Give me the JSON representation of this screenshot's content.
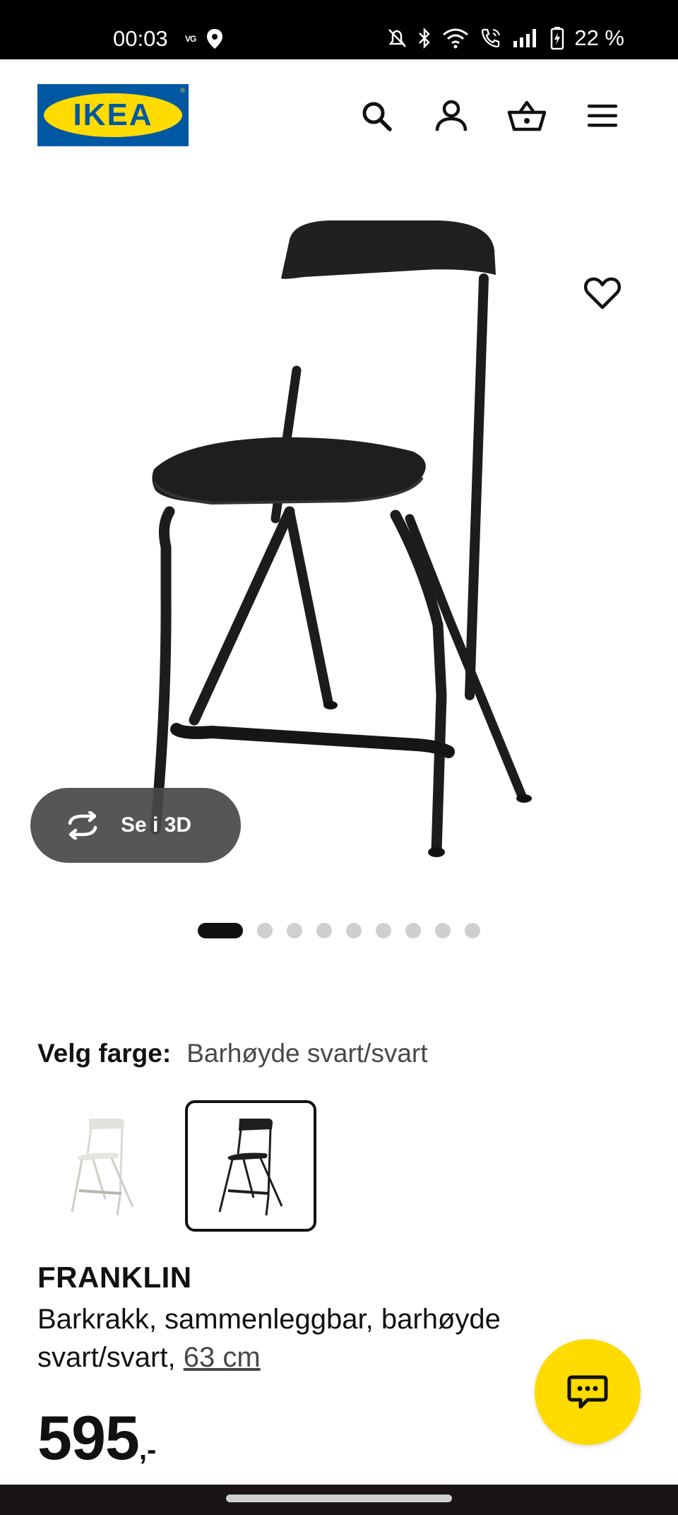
{
  "status_bar": {
    "time": "00:03",
    "carrier_badge": "VG",
    "battery": "22 %",
    "icons": [
      "vg-icon",
      "location-pin-icon",
      "mute-icon",
      "bluetooth-icon",
      "wifi-icon",
      "call-icon",
      "signal-icon",
      "battery-icon"
    ]
  },
  "header": {
    "logo_text": "IKEA",
    "icons": [
      "search-icon",
      "account-icon",
      "basket-icon",
      "menu-icon"
    ]
  },
  "gallery": {
    "view_3d_label": "Se i 3D",
    "dots_total": 9,
    "active_dot": 1
  },
  "color_select": {
    "label": "Velg farge:",
    "value": "Barhøyde svart/svart",
    "options": [
      "white",
      "black"
    ],
    "selected": "black"
  },
  "product": {
    "name": "FRANKLIN",
    "description": "Barkrakk, sammenleggbar, barhøyde svart/svart,",
    "measure": "63 cm",
    "price": "595",
    "price_suffix": ",-"
  },
  "colors": {
    "ikea_blue": "#0058a3",
    "ikea_yellow": "#ffdb00",
    "text": "#111111",
    "muted": "#484848"
  }
}
